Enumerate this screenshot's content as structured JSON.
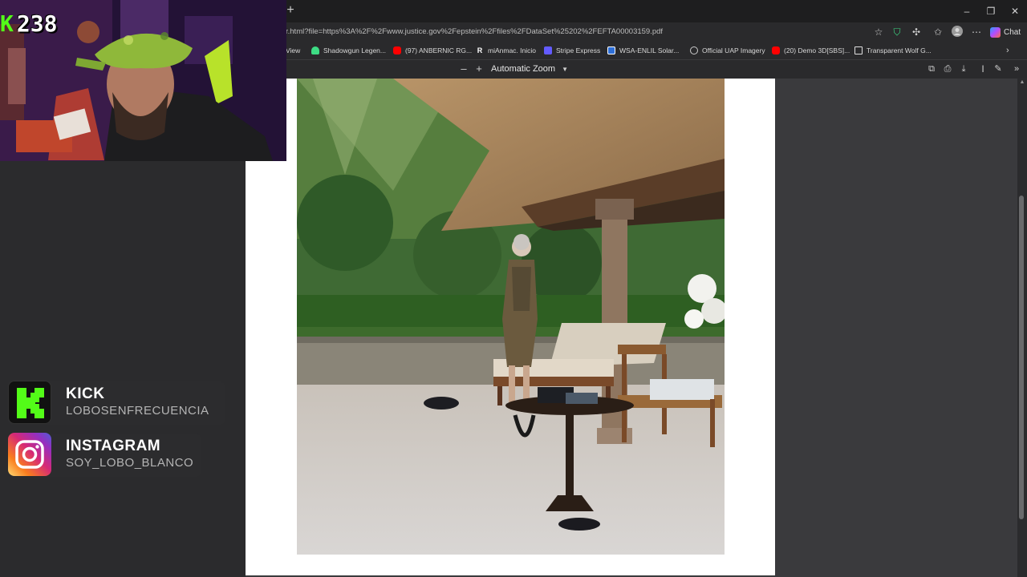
{
  "browser": {
    "url": "r.html?file=https%3A%2F%2Fwww.justice.gov%2Fepstein%2Ffiles%2FDataSet%25202%2FEFTA00003159.pdf",
    "chat_label": "Chat",
    "new_tab_glyph": "+",
    "window_controls": {
      "minimize": "–",
      "maximize": "❐",
      "close": "✕"
    }
  },
  "bookmarks": [
    {
      "label": "View",
      "color": ""
    },
    {
      "label": "Shadowgun Legen...",
      "color": "#3ddc84"
    },
    {
      "label": "(97) ANBERNIC RG...",
      "color": "#ff0000"
    },
    {
      "label": "miAnmac. Inicio",
      "color": "#ffffff"
    },
    {
      "label": "Stripe Express",
      "color": "#635bff"
    },
    {
      "label": "WSA-ENLIL Solar...",
      "color": "#2e6fd8"
    },
    {
      "label": "Official UAP Imagery",
      "color": "#cccccc"
    },
    {
      "label": "(20) Demo 3D[SBS]...",
      "color": "#ff0000"
    },
    {
      "label": "Transparent Wolf G...",
      "color": "#e0e0e0"
    }
  ],
  "pdf_toolbar": {
    "zoom_out": "–",
    "zoom_in": "+",
    "zoom_label": "Automatic Zoom"
  },
  "overlay": {
    "viewer_k": "K",
    "viewer_count": "238"
  },
  "socials": [
    {
      "title": "KICK",
      "handle": "LOBOSENFRECUENCIA",
      "accent": "#53fc18"
    },
    {
      "title": "INSTAGRAM",
      "handle": "SOY_LOBO_BLANCO",
      "accent": "#e1306c"
    }
  ]
}
